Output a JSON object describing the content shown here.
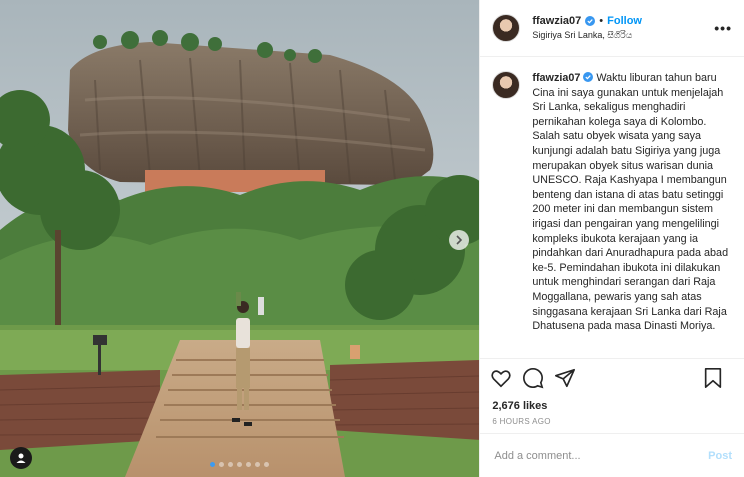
{
  "post": {
    "username": "ffawzia07",
    "follow_label": "Follow",
    "location": "Sigiriya Sri Lanka, සීගිරිය",
    "more_label": "•••",
    "caption": "Waktu liburan tahun baru Cina ini saya gunakan untuk menjelajah Sri Lanka, sekaligus menghadiri pernikahan kolega saya di Kolombo. Salah satu obyek wisata yang saya kunjungi adalah batu Sigiriya yang juga merupakan obyek situs warisan dunia UNESCO. Raja Kashyapa I membangun benteng dan istana di atas batu setinggi 200 meter ini dan membangun sistem irigasi dan pengairan yang mengelilingi kompleks ibukota kerajaan yang ia pindahkan dari Anuradhapura pada abad ke-5. Pemindahan ibukota ini dilakukan untuk menghindari serangan dari Raja Moggallana, pewaris yang sah atas singgasana kerajaan Sri Lanka dari Raja Dhatusena pada masa Dinasti Moriya.",
    "likes": "2,676 likes",
    "time": "6 HOURS AGO"
  },
  "comment_box": {
    "placeholder": "Add a comment...",
    "post_label": "Post"
  },
  "carousel": {
    "count": 7,
    "active_index": 0
  },
  "colors": {
    "accent": "#0095f6",
    "verified": "#3897f0",
    "post_disabled": "#b2dffc"
  },
  "icons": [
    "verified-icon",
    "more-icon",
    "heart-icon",
    "comment-icon",
    "share-icon",
    "bookmark-icon",
    "carousel-next-icon",
    "user-tag-icon"
  ]
}
